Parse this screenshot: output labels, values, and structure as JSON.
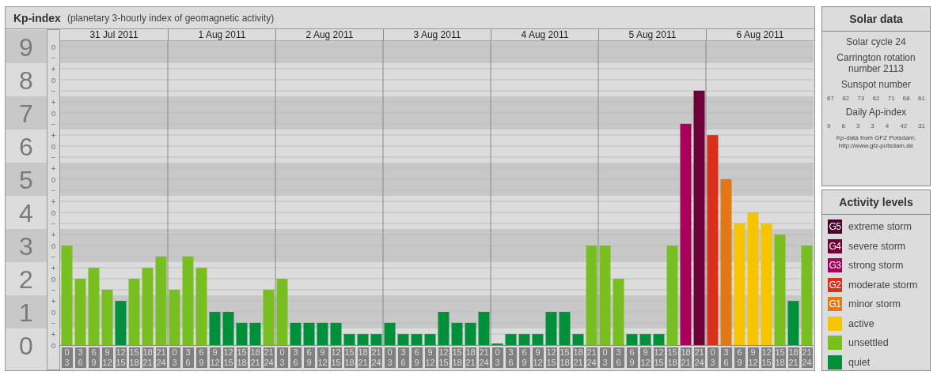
{
  "kp_panel": {
    "title": "Kp-index",
    "subtitle": "(planetary 3-hourly index of geomagnetic activity)",
    "days": [
      "31 Jul 2011",
      "1 Aug 2011",
      "2 Aug 2011",
      "3 Aug 2011",
      "4 Aug 2011",
      "5 Aug 2011",
      "6 Aug 2011"
    ],
    "minor_tick_labels": [
      "o",
      "−",
      "+",
      "o",
      "−",
      "+",
      "o",
      "−",
      "+",
      "o",
      "−",
      "+",
      "o",
      "−",
      "+",
      "o",
      "−",
      "+",
      "o",
      "−",
      "+",
      "o",
      "−",
      "+",
      "o",
      "−",
      "+",
      "o"
    ],
    "chart_data": {
      "type": "bar",
      "stacked": true,
      "grid": true,
      "bands": [
        {
          "axis": "y",
          "from": 0.5,
          "to": 1.5
        },
        {
          "axis": "y",
          "from": 2.5,
          "to": 3.5
        },
        {
          "axis": "y",
          "from": 4.5,
          "to": 5.5
        },
        {
          "axis": "y",
          "from": 6.5,
          "to": 7.5
        },
        {
          "axis": "y",
          "from": 8.5,
          "to": 9.5
        }
      ],
      "ylim": [
        0,
        9
      ],
      "yticks": [
        0,
        1,
        2,
        3,
        4,
        5,
        6,
        7,
        8,
        9
      ],
      "categories": [
        "0 3",
        "3 6",
        "6 9",
        "9 12",
        "12 15",
        "15 18",
        "18 21",
        "21 24",
        "0 3",
        "3 6",
        "6 9",
        "9 12",
        "12 15",
        "15 18",
        "18 21",
        "21 24",
        "0 3",
        "3 6",
        "6 9",
        "9 12",
        "12 15",
        "15 18",
        "18 21",
        "21 24",
        "0 3",
        "3 6",
        "6 9",
        "9 12",
        "12 15",
        "15 18",
        "18 21",
        "21 24",
        "0 3",
        "3 6",
        "6 9",
        "9 12",
        "12 15",
        "15 18",
        "18 21",
        "21 24",
        "0 3",
        "3 6",
        "6 9",
        "9 12",
        "12 15",
        "15 18",
        "18 21",
        "21 24",
        "0 3",
        "3 6",
        "6 9",
        "9 12",
        "12 15",
        "15 18",
        "18 21",
        "21 24"
      ],
      "series": [
        {
          "color": "#008f3b",
          "values": [
            null,
            null,
            null,
            null,
            1.33,
            null,
            null,
            null,
            null,
            null,
            null,
            1,
            1,
            0.67,
            0.67,
            null,
            null,
            0.67,
            0.67,
            0.67,
            0.67,
            0.33,
            0.33,
            0.33,
            0.67,
            0.33,
            0.33,
            0.33,
            1,
            0.67,
            0.67,
            1,
            0,
            0.33,
            0.33,
            0.33,
            1,
            1,
            0.33,
            null,
            null,
            null,
            0.33,
            0.33,
            0.33,
            null,
            null,
            null,
            null,
            null,
            null,
            null,
            null,
            null,
            1.33,
            null
          ]
        },
        {
          "color": "#7abf22",
          "values": [
            3,
            2,
            2.33,
            1.67,
            null,
            2,
            2.33,
            2.67,
            1.67,
            2.67,
            2.33,
            null,
            null,
            null,
            null,
            1.67,
            2,
            null,
            null,
            null,
            null,
            null,
            null,
            null,
            null,
            null,
            null,
            null,
            null,
            null,
            null,
            null,
            null,
            null,
            null,
            null,
            null,
            null,
            null,
            3,
            3,
            2,
            null,
            null,
            null,
            3,
            null,
            null,
            null,
            null,
            null,
            null,
            null,
            3.33,
            null,
            3
          ]
        },
        {
          "color": "#f8c400",
          "values": [
            null,
            null,
            null,
            null,
            null,
            null,
            null,
            null,
            null,
            null,
            null,
            null,
            null,
            null,
            null,
            null,
            null,
            null,
            null,
            null,
            null,
            null,
            null,
            null,
            null,
            null,
            null,
            null,
            null,
            null,
            null,
            null,
            null,
            null,
            null,
            null,
            null,
            null,
            null,
            null,
            null,
            null,
            null,
            null,
            null,
            null,
            null,
            null,
            null,
            null,
            3.67,
            4,
            3.67,
            null,
            null,
            null
          ]
        },
        {
          "color": "#e27818",
          "values": [
            null,
            null,
            null,
            null,
            null,
            null,
            null,
            null,
            null,
            null,
            null,
            null,
            null,
            null,
            null,
            null,
            null,
            null,
            null,
            null,
            null,
            null,
            null,
            null,
            null,
            null,
            null,
            null,
            null,
            null,
            null,
            null,
            null,
            null,
            null,
            null,
            null,
            null,
            null,
            null,
            null,
            null,
            null,
            null,
            null,
            null,
            null,
            null,
            null,
            5,
            null,
            null,
            null,
            null,
            null,
            null
          ]
        },
        {
          "color": "#d9301c",
          "values": [
            null,
            null,
            null,
            null,
            null,
            null,
            null,
            null,
            null,
            null,
            null,
            null,
            null,
            null,
            null,
            null,
            null,
            null,
            null,
            null,
            null,
            null,
            null,
            null,
            null,
            null,
            null,
            null,
            null,
            null,
            null,
            null,
            null,
            null,
            null,
            null,
            null,
            null,
            null,
            null,
            null,
            null,
            null,
            null,
            null,
            null,
            null,
            null,
            6.33,
            null,
            null,
            null,
            null,
            null,
            null,
            null
          ]
        },
        {
          "color": "#a8005a",
          "values": [
            null,
            null,
            null,
            null,
            null,
            null,
            null,
            null,
            null,
            null,
            null,
            null,
            null,
            null,
            null,
            null,
            null,
            null,
            null,
            null,
            null,
            null,
            null,
            null,
            null,
            null,
            null,
            null,
            null,
            null,
            null,
            null,
            null,
            null,
            null,
            null,
            null,
            null,
            null,
            null,
            null,
            null,
            null,
            null,
            null,
            null,
            6.67,
            null,
            null,
            null,
            null,
            null,
            null,
            null,
            null,
            null
          ]
        },
        {
          "color": "#6e0038",
          "values": [
            null,
            null,
            null,
            null,
            null,
            null,
            null,
            null,
            null,
            null,
            null,
            null,
            null,
            null,
            null,
            null,
            null,
            null,
            null,
            null,
            null,
            null,
            null,
            null,
            null,
            null,
            null,
            null,
            null,
            null,
            null,
            null,
            null,
            null,
            null,
            null,
            null,
            null,
            null,
            null,
            null,
            null,
            null,
            null,
            null,
            null,
            null,
            7.67,
            null,
            null,
            null,
            null,
            null,
            null,
            null,
            null
          ]
        }
      ]
    }
  },
  "solar_data": {
    "title": "Solar data",
    "cycle": "Solar cycle 24",
    "carrington": "Carrington rotation number 2113",
    "sunspot_label": "Sunspot number",
    "sunspot_numbers": [
      "67",
      "82",
      "73",
      "62",
      "71",
      "68",
      "61"
    ],
    "ap_label": "Daily Ap-index",
    "ap_values": [
      "9",
      "6",
      "3",
      "3",
      "4",
      "42",
      "31"
    ],
    "credit": "Kp-data from GFZ Potsdam:",
    "credit_url": "http://www.gfz-potsdam.de"
  },
  "activity_levels": {
    "title": "Activity levels",
    "items": [
      {
        "badge": "G5",
        "label": "extreme storm",
        "color": "#4a0028"
      },
      {
        "badge": "G4",
        "label": "severe storm",
        "color": "#6e0038"
      },
      {
        "badge": "G3",
        "label": "strong storm",
        "color": "#a8005a"
      },
      {
        "badge": "G2",
        "label": "moderate storm",
        "color": "#d9301c"
      },
      {
        "badge": "G1",
        "label": "minor storm",
        "color": "#e27818"
      },
      {
        "label": "active",
        "color": "#f8c400"
      },
      {
        "label": "unsettled",
        "color": "#7abf22"
      },
      {
        "label": "quiet",
        "color": "#008f3b"
      }
    ]
  }
}
